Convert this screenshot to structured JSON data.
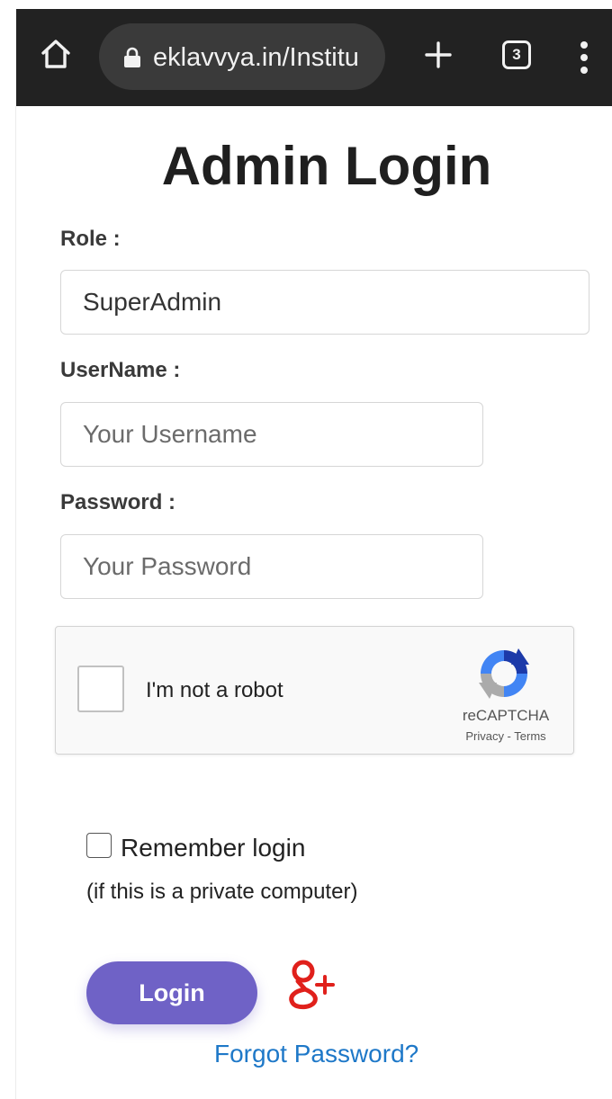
{
  "browser": {
    "url": "eklavvya.in/Institu",
    "tab_count": "3",
    "icons": [
      "home-icon",
      "lock-icon",
      "plus-icon",
      "tabs-icon",
      "menu-dots-icon"
    ]
  },
  "page": {
    "title": "Admin Login"
  },
  "form": {
    "role_label": "Role :",
    "role_value": "SuperAdmin",
    "username_label": "UserName :",
    "username_placeholder": "Your Username",
    "password_label": "Password :",
    "password_placeholder": "Your Password"
  },
  "recaptcha": {
    "label": "I'm not a robot",
    "brand": "reCAPTCHA",
    "links": "Privacy - Terms",
    "checked": false
  },
  "remember": {
    "label": "Remember login",
    "note": "(if this is a private computer)",
    "checked": false
  },
  "actions": {
    "login_label": "Login",
    "forgot_label": "Forgot Password?",
    "social_icon": "google-plus-icon"
  },
  "colors": {
    "topbar": "#222222",
    "url_pill": "#3a3a3a",
    "login_button": "#6f62c6",
    "forgot_link": "#1e78c8",
    "google_plus": "#e0201b"
  }
}
